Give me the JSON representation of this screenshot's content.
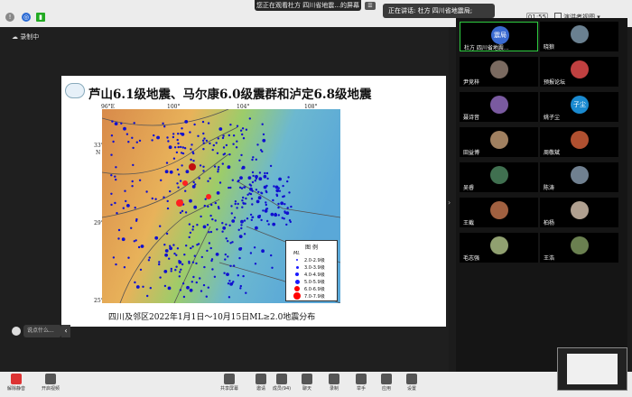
{
  "top_bar": {
    "viewing_banner": "您正在观看杜方 四川省地震...的屏幕",
    "viewing_button": "☰",
    "speaking": "正在讲话: 杜方 四川省地震局;",
    "time": "01:55",
    "view_mode": "演讲者视图"
  },
  "recording": {
    "label": "录制中"
  },
  "slide": {
    "title": "芦山6.1级地震、马尔康6.0级震群和泸定6.8级地震",
    "caption": "四川及邻区2022年1月1日～10月15日ML≥2.0地震分布",
    "axes": {
      "x_ticks": [
        "96°E",
        "100°",
        "104°",
        "108°"
      ],
      "y_ticks": [
        "33°",
        "N",
        "29°",
        "25°"
      ]
    },
    "legend": {
      "title": "图 例",
      "subtitle": "ML",
      "items": [
        {
          "label": "2.0-2.9级",
          "color": "#1a1aff"
        },
        {
          "label": "3.0-3.9级",
          "color": "#1a1aff"
        },
        {
          "label": "4.0-4.9级",
          "color": "#1a1aff"
        },
        {
          "label": "5.0-5.9级",
          "color": "#1a1aff"
        },
        {
          "label": "6.0-6.9级",
          "color": "#ff0000"
        },
        {
          "label": "7.0-7.9级",
          "color": "#ff0000"
        }
      ]
    }
  },
  "chat": {
    "placeholder": "说点什么..."
  },
  "participants": [
    {
      "name": "杜方 四川省地震...",
      "avatar": "震局"
    },
    {
      "name": "晓狼",
      "avatar": ""
    },
    {
      "name": "尹竞梓",
      "avatar": ""
    },
    {
      "name": "预报论坛",
      "avatar": ""
    },
    {
      "name": "聂诗音",
      "avatar": ""
    },
    {
      "name": "姚子尘",
      "avatar": "子尘"
    },
    {
      "name": "田益博",
      "avatar": ""
    },
    {
      "name": "周敬斌",
      "avatar": ""
    },
    {
      "name": "吴睿",
      "avatar": ""
    },
    {
      "name": "陈涛",
      "avatar": ""
    },
    {
      "name": "王截",
      "avatar": ""
    },
    {
      "name": "柏杨",
      "avatar": ""
    },
    {
      "name": "毛志强",
      "avatar": ""
    },
    {
      "name": "王浩",
      "avatar": ""
    }
  ],
  "bottom_bar": {
    "buttons": [
      "解除静音",
      "开启视频",
      "共享屏幕",
      "邀请",
      "成员(94)",
      "聊天",
      "录制",
      "举手",
      "应用",
      "设置"
    ]
  }
}
